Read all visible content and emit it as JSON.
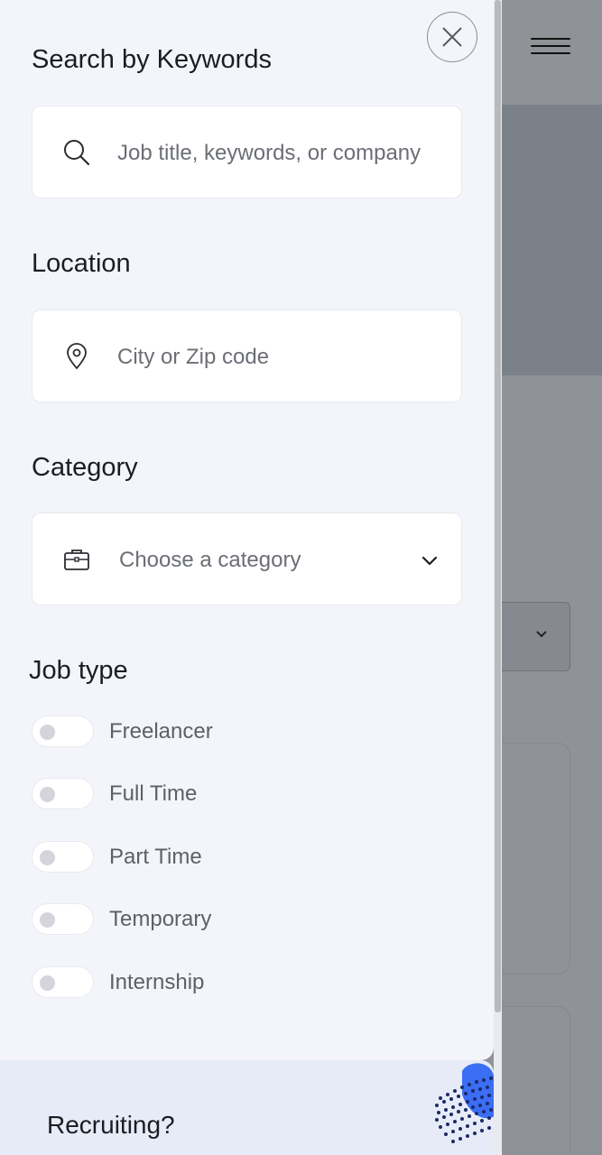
{
  "drawer": {
    "search": {
      "title": "Search by Keywords",
      "placeholder": "Job title, keywords, or company",
      "icon": "search-icon"
    },
    "location": {
      "title": "Location",
      "placeholder": "City or Zip code",
      "icon": "map-pin-icon"
    },
    "category": {
      "title": "Category",
      "selected": "Choose a category",
      "icon": "briefcase-icon"
    },
    "job_type": {
      "title": "Job type",
      "options": [
        {
          "label": "Freelancer",
          "checked": false
        },
        {
          "label": "Full Time",
          "checked": false
        },
        {
          "label": "Part Time",
          "checked": false
        },
        {
          "label": "Temporary",
          "checked": false
        },
        {
          "label": "Internship",
          "checked": false
        }
      ]
    },
    "close_icon": "close-icon"
  },
  "recruit_card": {
    "title": "Recruiting?"
  },
  "colors": {
    "drawer_bg": "#f3f5fb",
    "field_bg": "#ffffff",
    "accent_blue": "#3b6ef5",
    "overlay": "#8f9297"
  }
}
